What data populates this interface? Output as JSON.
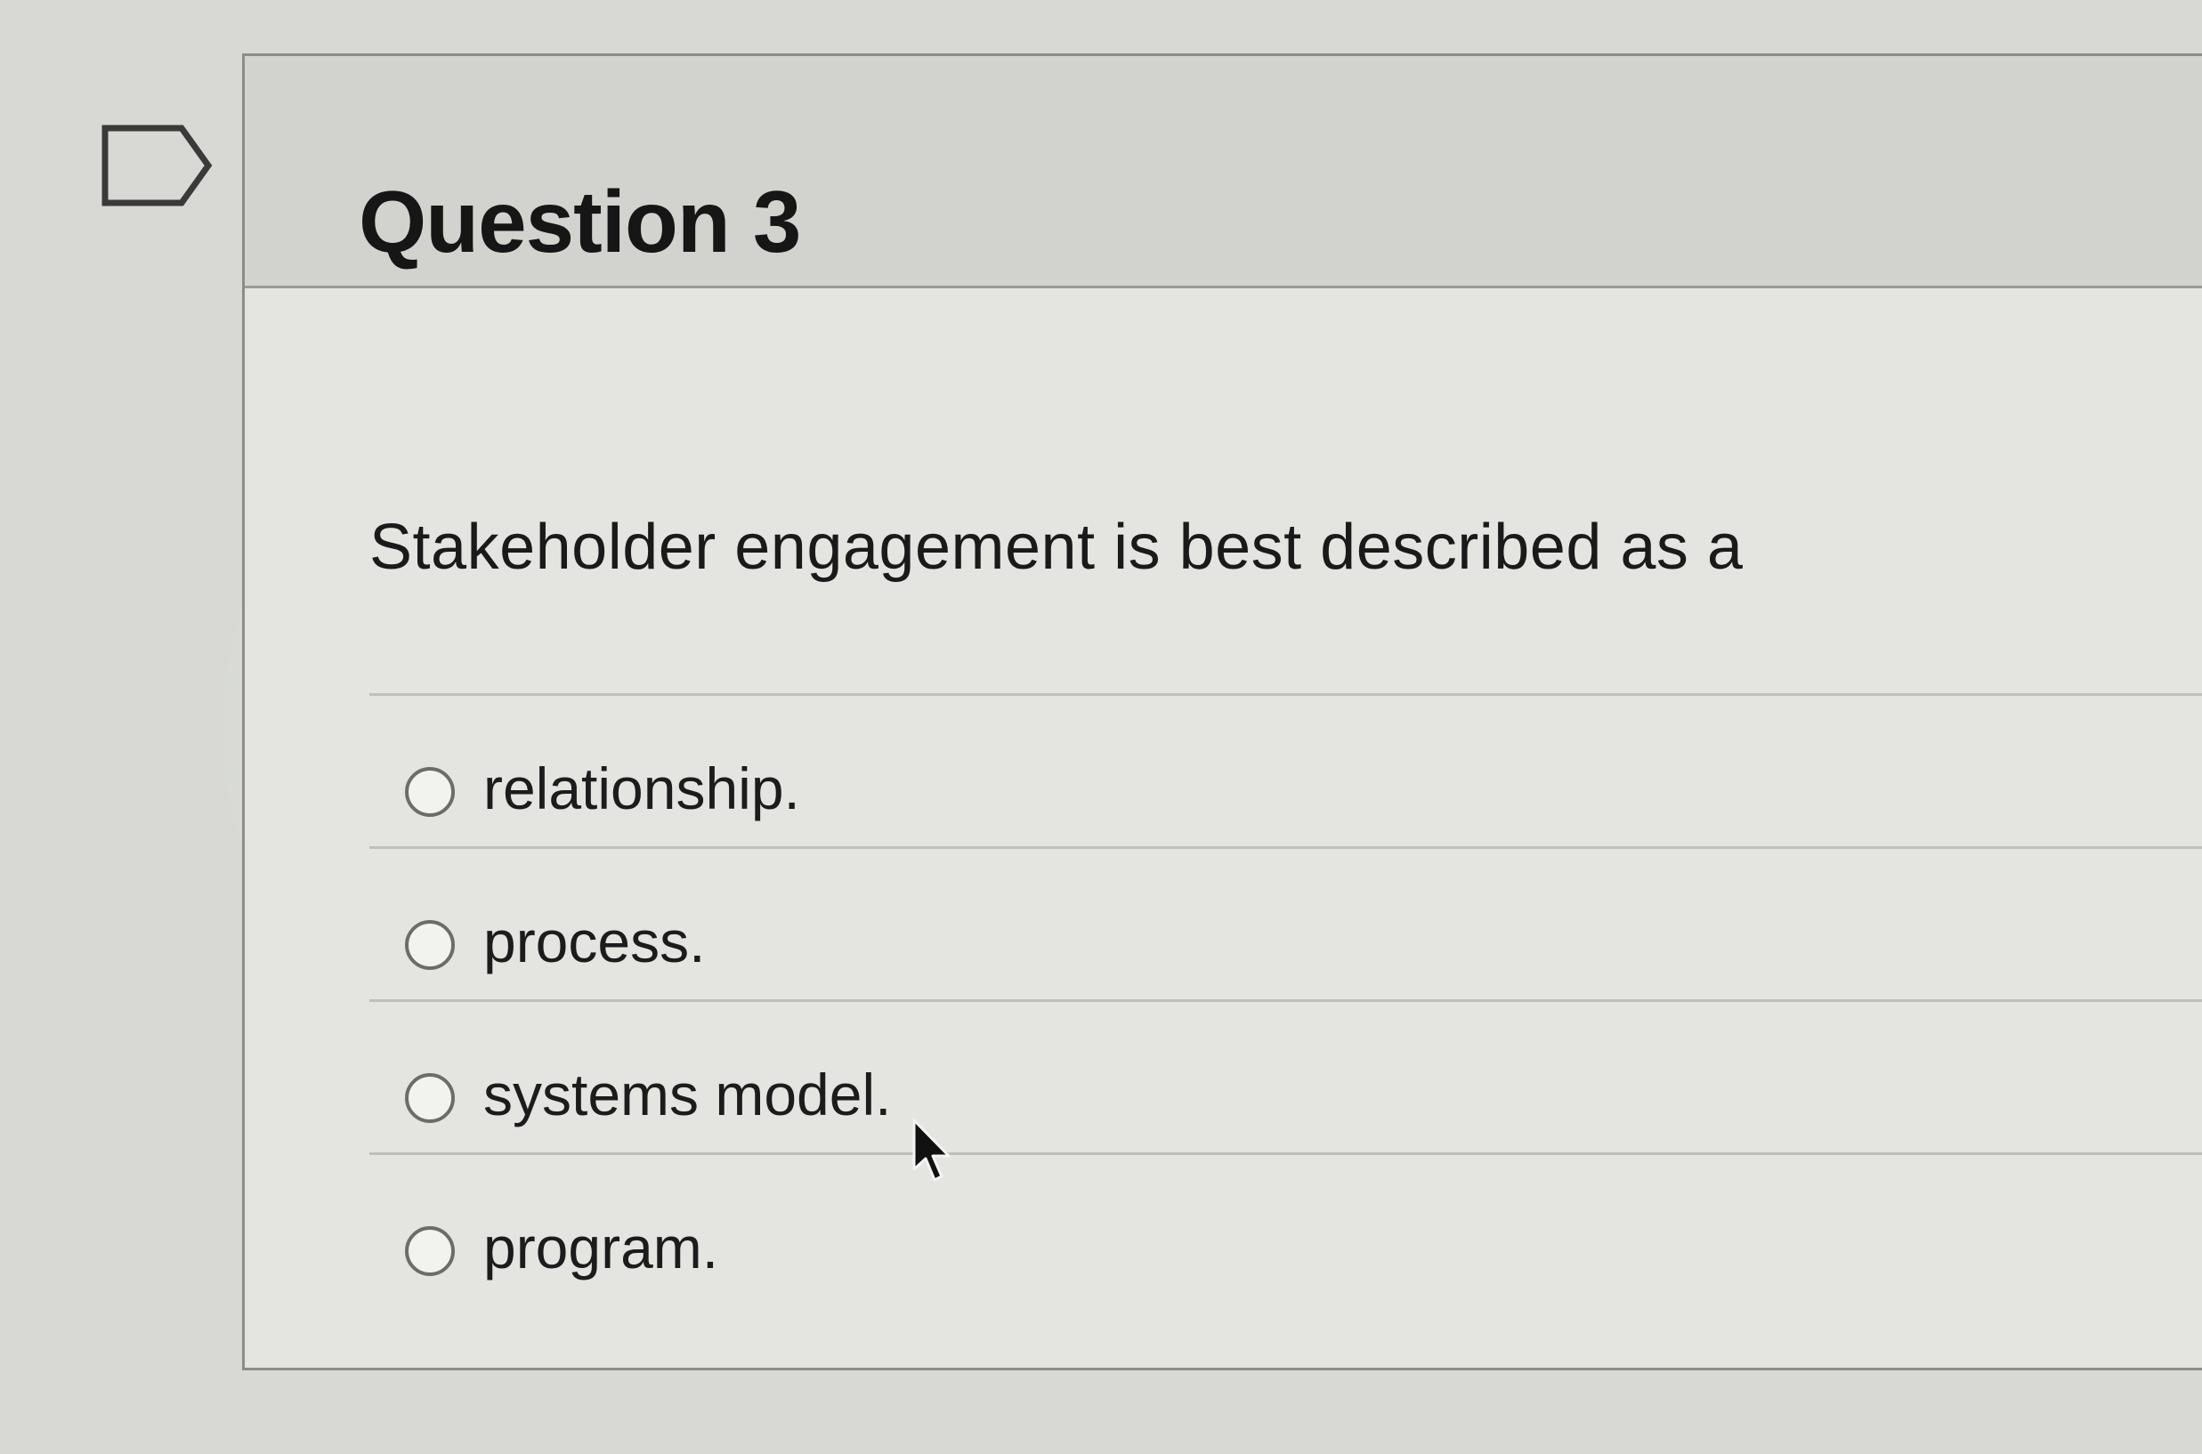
{
  "icons": {
    "flag": "flag-outline-icon",
    "cursor": "mouse-pointer-icon"
  },
  "question": {
    "title": "Question 3",
    "text": "Stakeholder engagement is best described as a",
    "answers": [
      {
        "label": "relationship.",
        "selected": false
      },
      {
        "label": "process.",
        "selected": false
      },
      {
        "label": "systems model.",
        "selected": false
      },
      {
        "label": "program.",
        "selected": false
      }
    ]
  },
  "colors": {
    "header_bg": "#d2d3cf",
    "card_bg": "#e4e5e1",
    "text": "#1a1a1a"
  }
}
